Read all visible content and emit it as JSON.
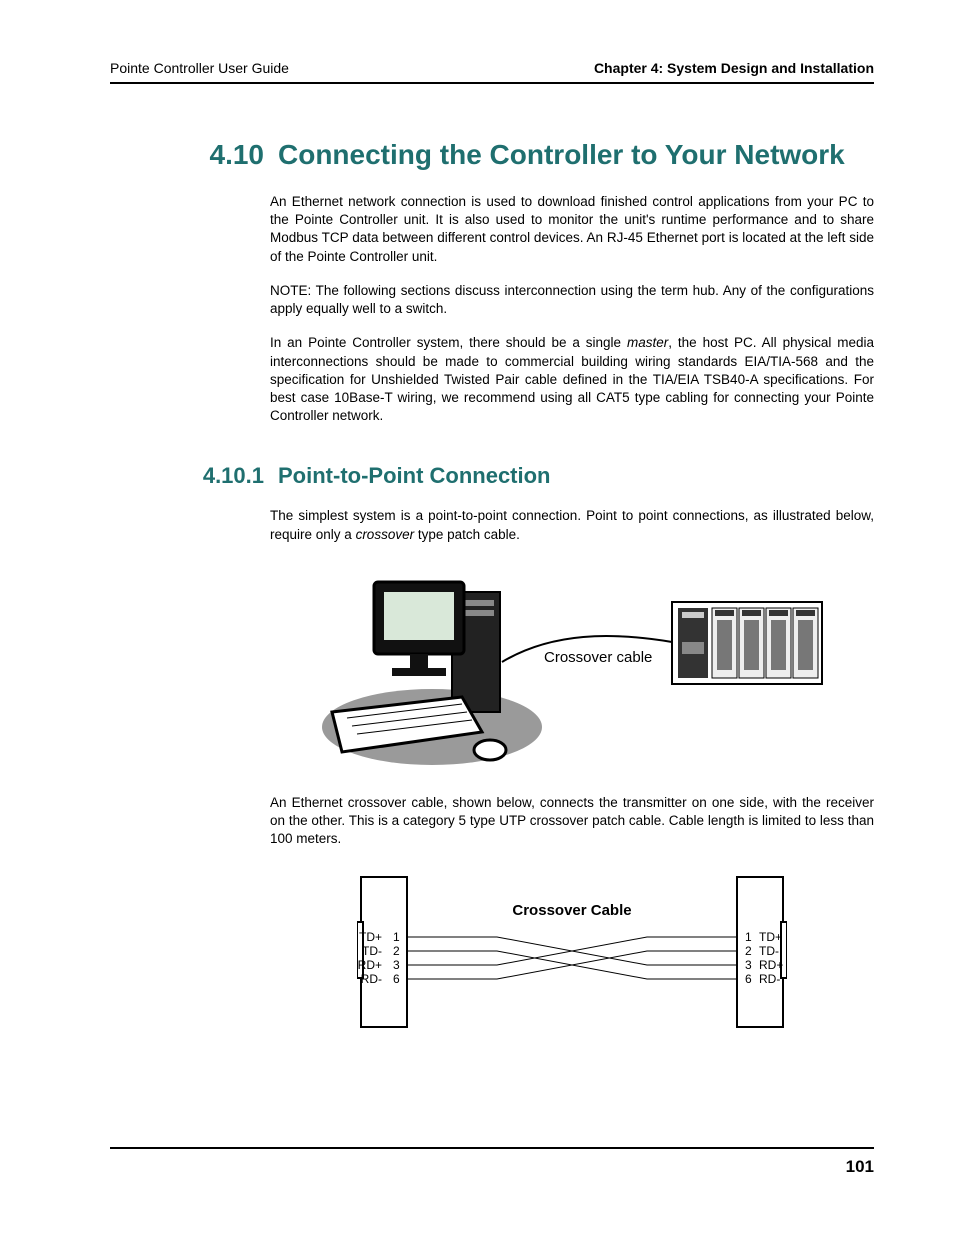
{
  "header": {
    "left": "Pointe Controller User Guide",
    "right": "Chapter 4: System Design and Installation"
  },
  "section": {
    "number": "4.10",
    "title": "Connecting the Controller to Your Network"
  },
  "paragraphs": {
    "p1": "An Ethernet network connection is used to download finished control applications from your PC to the Pointe Controller unit. It is also used to monitor the unit's runtime performance and to share Modbus TCP data between different control devices. An RJ-45 Ethernet port is located at the left side of the Pointe Controller unit.",
    "p2": "NOTE: The following sections discuss interconnection using the term hub. Any of the configurations apply equally well to a switch.",
    "p3_a": "In an Pointe Controller system, there should be a single ",
    "p3_em": "master",
    "p3_b": ", the host PC. All physical media interconnections should be made to commercial building wiring standards EIA/TIA-568 and the specification for Unshielded Twisted Pair cable defined in the TIA/EIA TSB40-A specifications. For best case 10Base-T wiring, we recommend using all CAT5 type cabling for connecting your Pointe Controller network."
  },
  "subsection": {
    "number": "4.10.1",
    "title": "Point-to-Point Connection"
  },
  "sub_paragraphs": {
    "p1_a": "The simplest system is a point-to-point connection. Point to point connections, as illustrated below, require only a ",
    "p1_em": "crossover",
    "p1_b": " type patch cable.",
    "p2": "An Ethernet crossover cable, shown below, connects the transmitter on one side, with the receiver on the other. This is a category 5 type UTP crossover patch cable. Cable length is limited to less than 100 meters."
  },
  "figure1": {
    "label": "Crossover cable"
  },
  "figure2": {
    "title": "Crossover Cable",
    "left_pins": [
      "TD+",
      "TD-",
      "RD+",
      "RD-"
    ],
    "left_nums": [
      "1",
      "2",
      "3",
      "6"
    ],
    "right_nums": [
      "1",
      "2",
      "3",
      "6"
    ],
    "right_pins": [
      "TD+",
      "TD-",
      "RD+",
      "RD-"
    ]
  },
  "page_number": "101"
}
